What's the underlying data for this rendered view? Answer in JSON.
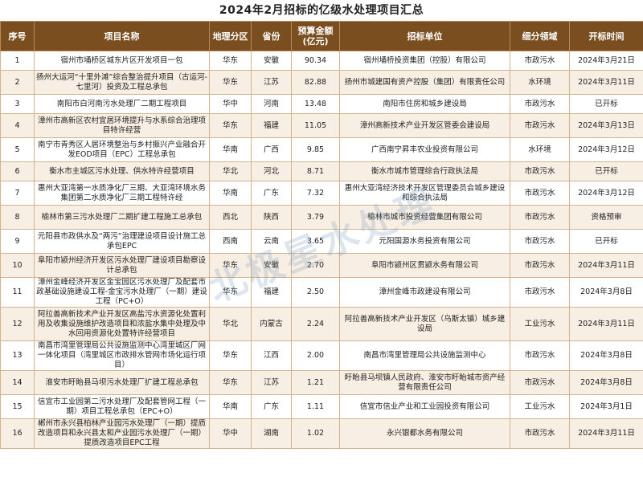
{
  "title": "2024年2月招标的亿级水处理项目汇总",
  "headers": [
    "序号",
    "项目名称",
    "地理分区",
    "省份",
    "预算金额(亿元)",
    "招标单位",
    "细分领域",
    "开标时间"
  ],
  "watermark": "北极星水处理",
  "rows": [
    {
      "no": "1",
      "name": "宿州市埇桥区城东片区开发项目一包",
      "region": "华东",
      "province": "安徽",
      "amount": "90.34",
      "org": "宿州埇桥投资集团（控股）有限公司",
      "field": "市政污水",
      "date": "2024年3月21日"
    },
    {
      "no": "2",
      "name": "扬州大运河“十里外滩”综合整治提升项目（古运河-七里河）投资及工程总承包",
      "region": "华东",
      "province": "江苏",
      "amount": "82.88",
      "org": "扬州市城建国有资产控股（集团）有限责任公司",
      "field": "水环境",
      "date": "2024年3月11日"
    },
    {
      "no": "3",
      "name": "南阳市白河南污水处理厂二期工程项目",
      "region": "华中",
      "province": "河南",
      "amount": "13.48",
      "org": "南阳市住房和城乡建设局",
      "field": "市政污水",
      "date": "已开标"
    },
    {
      "no": "4",
      "name": "漳州市高新区农村宜居环境提升与水系综合治理项目特许经营",
      "region": "华东",
      "province": "福建",
      "amount": "11.05",
      "org": "漳州高新技术产业开发区管委会建设局",
      "field": "市政污水",
      "date": "2024年3月13日"
    },
    {
      "no": "5",
      "name": "南宁市青秀区人居环境整治与乡村振兴产业融合开发EOD项目（EPC）工程总承包",
      "region": "华南",
      "province": "广西",
      "amount": "9.85",
      "org": "广西南宁昇丰农业投资有限公司",
      "field": "水环境",
      "date": "2024年3月12日"
    },
    {
      "no": "6",
      "name": "衡水市主城区污水处理、供水特许经营项目",
      "region": "华北",
      "province": "河北",
      "amount": "8.71",
      "org": "衡水市城市管理综合行政执法局",
      "field": "市政污水",
      "date": "已开标"
    },
    {
      "no": "7",
      "name": "惠州大亚湾第一水质净化厂三期、大亚湾环境水务集团第二水质净化厂三期工程特许经",
      "region": "华南",
      "province": "广东",
      "amount": "7.32",
      "org": "惠州大亚湾经济技术开发区管理委员会城乡建设和综合执法局",
      "field": "市政污水",
      "date": "2024年3月12日"
    },
    {
      "no": "8",
      "name": "榆林市第三污水处理厂二期扩建工程施工总承包",
      "region": "西北",
      "province": "陕西",
      "amount": "3.79",
      "org": "榆林市城市投资经营集团有限公司",
      "field": "市政污水",
      "date": "资格预审"
    },
    {
      "no": "9",
      "name": "元阳县市政供水及“两污”治理建设项目设计施工总承包EPC",
      "region": "西南",
      "province": "云南",
      "amount": "3.65",
      "org": "元阳国源水务投资有限公司",
      "field": "市政污水",
      "date": "已开标"
    },
    {
      "no": "10",
      "name": "阜阳市颍州经济开发区污水处理厂建设项目勘察设计总承包",
      "region": "华东",
      "province": "安徽",
      "amount": "2.70",
      "org": "阜阳市颍州区贯颍水务有限公司",
      "field": "市政污水",
      "date": "2024年3月11日"
    },
    {
      "no": "11",
      "name": "漳州金峰经济开发区金宝园区污水处理厂及配套市政基础设施建设工程-金宝污水处理厂（一期）建设工程（PC+O）",
      "region": "华东",
      "province": "福建",
      "amount": "2.50",
      "org": "漳州金峰市政建设有限公司",
      "field": "市政污水",
      "date": "2024年3月8日"
    },
    {
      "no": "12",
      "name": "阿拉善高新技术产业开发区高盐污水资源化处置利用及收集设施维护改造项目和浓盐水集中处理及中水回用资源化处置特许经营项目",
      "region": "华北",
      "province": "内蒙古",
      "amount": "2.24",
      "org": "阿拉善高新技术产业开发区（乌斯太镇）城乡建设局",
      "field": "工业污水",
      "date": "2024年3月11日"
    },
    {
      "no": "13",
      "name": "南昌市湾里管理局公共设施监测中心湾里城区厂网一体化项目（湾里城区市政排水管网市场化运行项目）",
      "region": "华东",
      "province": "江西",
      "amount": "2.00",
      "org": "南昌市湾里管理局公共设施监测中心",
      "field": "市政污水",
      "date": "2024年3月8日"
    },
    {
      "no": "14",
      "name": "淮安市盱眙县马坝污水处理厂扩建工程总承包",
      "region": "华东",
      "province": "江苏",
      "amount": "1.21",
      "org": "盱眙县马坝镇人民政府、淮安市盱眙城市资产经营有限责任公司",
      "field": "市政污水",
      "date": "2024年3月8日"
    },
    {
      "no": "15",
      "name": "信宜市工业园第二污水处理厂及配套管网工程（一期）项目工程总承包（EPC+O）",
      "region": "华南",
      "province": "广东",
      "amount": "1.11",
      "org": "信宜市信业产业和工业园投资有限公司",
      "field": "工业污水",
      "date": "2024年3月1日"
    },
    {
      "no": "16",
      "name": "郴州市永兴县柏林产业园污水处理厂（一期）提质改造项目和永兴县太和产业园污水处理厂（一期）提质改造项目EPC工程",
      "region": "华中",
      "province": "湖南",
      "amount": "1.02",
      "org": "永兴银都水务有限公司",
      "field": "市政污水",
      "date": "2024年3月11日"
    }
  ]
}
